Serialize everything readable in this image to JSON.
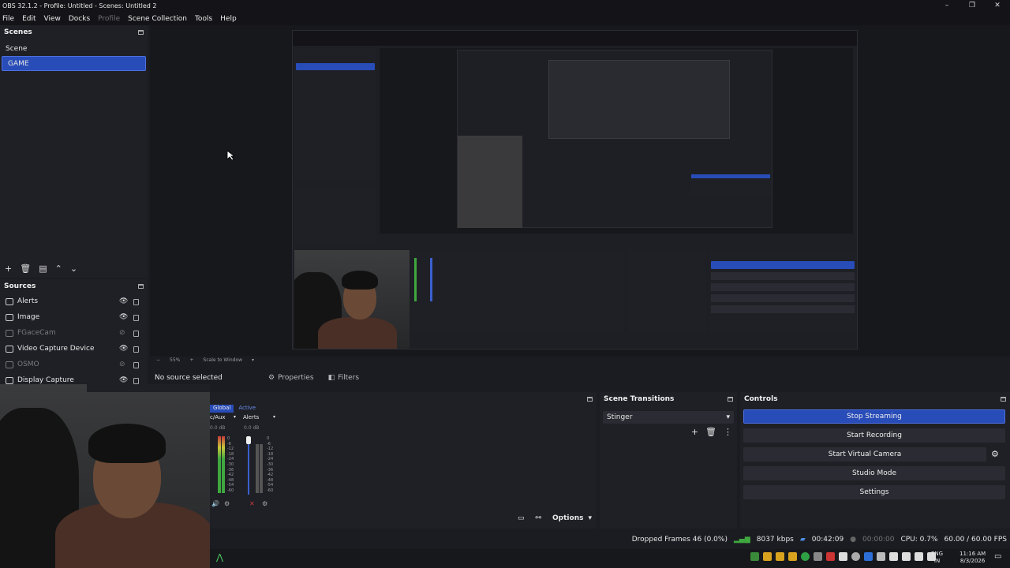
{
  "window": {
    "title": "OBS 32.1.2 - Profile: Untitled - Scenes: Untitled 2",
    "controls": [
      "–",
      "❐",
      "✕"
    ]
  },
  "menu": [
    "File",
    "Edit",
    "View",
    "Docks",
    "Profile",
    "Scene Collection",
    "Tools",
    "Help"
  ],
  "scenes": {
    "title": "Scenes",
    "items": [
      {
        "label": "Scene",
        "active": false
      },
      {
        "label": "GAME",
        "active": true
      }
    ]
  },
  "sources": {
    "title": "Sources",
    "items": [
      {
        "label": "Alerts",
        "visible": true
      },
      {
        "label": "Image",
        "visible": true
      },
      {
        "label": "FGaceCam",
        "visible": false
      },
      {
        "label": "Video Capture Device",
        "visible": true
      },
      {
        "label": "OSMO",
        "visible": false
      },
      {
        "label": "Display Capture",
        "visible": true
      }
    ]
  },
  "canvas": {
    "zoom": "55%",
    "scale": "Scale to Window"
  },
  "props_bar": {
    "status": "No source selected",
    "properties": "Properties",
    "filters": "Filters"
  },
  "mixer": {
    "tabs": [
      "Global",
      "Active"
    ],
    "channels": [
      {
        "name": "c/Aux",
        "db": "0.0 dB"
      },
      {
        "name": "Alerts",
        "db": "0.0 dB"
      }
    ],
    "ticks": [
      "0",
      "-6",
      "-12",
      "-18",
      "-24",
      "-30",
      "-36",
      "-42",
      "-48",
      "-54",
      "-60"
    ],
    "options": "Options"
  },
  "transitions": {
    "title": "Scene Transitions",
    "selected": "Stinger"
  },
  "controls": {
    "title": "Controls",
    "stop_streaming": "Stop Streaming",
    "start_recording": "Start Recording",
    "start_virtual_camera": "Start Virtual Camera",
    "studio_mode": "Studio Mode",
    "settings": "Settings"
  },
  "status": {
    "dropped_frames": "Dropped Frames 46 (0.0%)",
    "bitrate": "8037 kbps",
    "stream_time": "00:42:09",
    "rec_time": "00:00:00",
    "cpu": "CPU: 0.7%",
    "fps": "60.00 / 60.00 FPS"
  },
  "taskbar": {
    "lang_top": "ENG",
    "lang_bottom": "IN",
    "time": "11:16 AM",
    "date": "8/3/2026"
  },
  "colors": {
    "accent": "#284cb8",
    "dock_bg": "#1f2026",
    "window_bg": "#1b1c21"
  }
}
